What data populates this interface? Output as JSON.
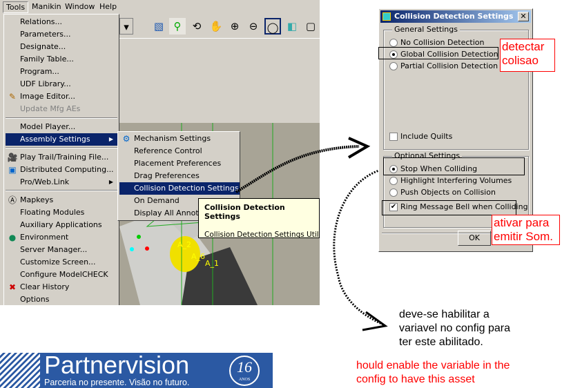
{
  "menubar": [
    "Tools",
    "Manikin",
    "Window",
    "Help"
  ],
  "tools_menu": {
    "group1": [
      {
        "label": "Relations..."
      },
      {
        "label": "Parameters..."
      },
      {
        "label": "Designate..."
      },
      {
        "label": "Family Table..."
      },
      {
        "label": "Program..."
      },
      {
        "label": "UDF Library..."
      },
      {
        "label": "Image Editor...",
        "icon": "image-editor-icon"
      },
      {
        "label": "Update Mfg AEs",
        "disabled": true
      }
    ],
    "group2": [
      {
        "label": "Model Player..."
      },
      {
        "label": "Assembly Settings",
        "submenu": true,
        "selected": true
      }
    ],
    "group3": [
      {
        "label": "Play Trail/Training File...",
        "icon": "camera-icon"
      },
      {
        "label": "Distributed Computing...",
        "icon": "computer-icon"
      },
      {
        "label": "Pro/Web.Link",
        "submenu": true
      }
    ],
    "group4": [
      {
        "label": "Mapkeys",
        "icon": "mapkey-icon"
      },
      {
        "label": "Floating Modules"
      },
      {
        "label": "Auxiliary Applications"
      },
      {
        "label": "Environment",
        "icon": "globe-icon"
      },
      {
        "label": "Server Manager..."
      },
      {
        "label": "Customize Screen..."
      },
      {
        "label": "Configure ModelCHECK"
      },
      {
        "label": "Clear History",
        "icon": "clear-history-icon"
      },
      {
        "label": "Options"
      }
    ]
  },
  "submenu": [
    {
      "label": "Mechanism Settings"
    },
    {
      "label": "Reference Control"
    },
    {
      "label": "Placement Preferences"
    },
    {
      "label": "Drag Preferences"
    },
    {
      "label": "Collision Detection Settings",
      "selected": true
    },
    {
      "label": "On Demand"
    },
    {
      "label": "Display All Annotations"
    }
  ],
  "tooltip": {
    "title": "Collision Detection Settings",
    "desc": "Collision Detection Settings Utility"
  },
  "viewport_labels": [
    "A_2",
    "A_6",
    "A_1"
  ],
  "dialog": {
    "title": "Collision Detection Settings",
    "general": {
      "label": "General Settings",
      "options": [
        "No Collision Detection",
        "Global Collision Detection",
        "Partial Collision Detection"
      ],
      "selected": 1,
      "include_quilts": {
        "label": "Include Quilts",
        "checked": false
      }
    },
    "optional": {
      "label": "Optional Settings",
      "options": [
        "Stop When Colliding",
        "Highlight Interfering Volumes",
        "Push Objects on Collision"
      ],
      "selected": 0,
      "ring_bell": {
        "label": "Ring Message Bell when Colliding",
        "checked": true
      }
    },
    "ok": "OK"
  },
  "annotations": {
    "detect": [
      "detectar",
      "colisao"
    ],
    "sound": [
      "ativar para",
      "emitir Som."
    ],
    "note_pt": [
      "deve-se habilitar a",
      "variavel no config para",
      "ter este abilitado."
    ],
    "note_en": [
      "hould enable the variable in the",
      "config to have this asset"
    ],
    "color": "#ff0000"
  },
  "logo": {
    "name": "Partnervision",
    "tagline": "Parceria no presente. Visão no futuro.",
    "badge": "16",
    "badge_sub": "ANOS",
    "color": "#2b59a3"
  }
}
